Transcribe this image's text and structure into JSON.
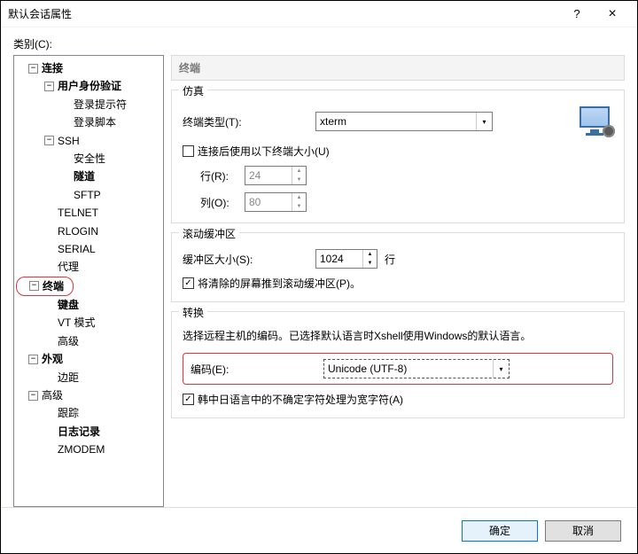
{
  "window": {
    "title": "默认会话属性",
    "help": "?",
    "close": "×"
  },
  "category_label": "类别(C):",
  "tree": {
    "connection": "连接",
    "userauth": "用户身份验证",
    "loginprompt": "登录提示符",
    "loginscript": "登录脚本",
    "ssh": "SSH",
    "security": "安全性",
    "tunnel": "隧道",
    "sftp": "SFTP",
    "telnet": "TELNET",
    "rlogin": "RLOGIN",
    "serial": "SERIAL",
    "proxy": "代理",
    "terminal": "终端",
    "keyboard": "键盘",
    "vtmode": "VT 模式",
    "advanced_t": "高级",
    "appearance": "外观",
    "margin": "边距",
    "advanced": "高级",
    "trace": "跟踪",
    "logging": "日志记录",
    "zmodem": "ZMODEM"
  },
  "header": "终端",
  "emulation": {
    "group": "仿真",
    "type_label": "终端类型(T):",
    "type_value": "xterm",
    "use_size_label": "连接后使用以下终端大小(U)",
    "use_size_checked": false,
    "rows_label": "行(R):",
    "rows_value": "24",
    "cols_label": "列(O):",
    "cols_value": "80"
  },
  "scrollback": {
    "group": "滚动缓冲区",
    "size_label": "缓冲区大小(S):",
    "size_value": "1024",
    "size_suffix": "行",
    "push_label": "将清除的屏幕推到滚动缓冲区(P)。",
    "push_checked": true
  },
  "translation": {
    "group": "转换",
    "desc": "选择远程主机的编码。已选择默认语言时Xshell使用Windows的默认语言。",
    "encoding_label": "编码(E):",
    "encoding_value": "Unicode (UTF-8)",
    "cjk_label": "韩中日语言中的不确定字符处理为宽字符(A)",
    "cjk_checked": true
  },
  "buttons": {
    "ok": "确定",
    "cancel": "取消"
  }
}
